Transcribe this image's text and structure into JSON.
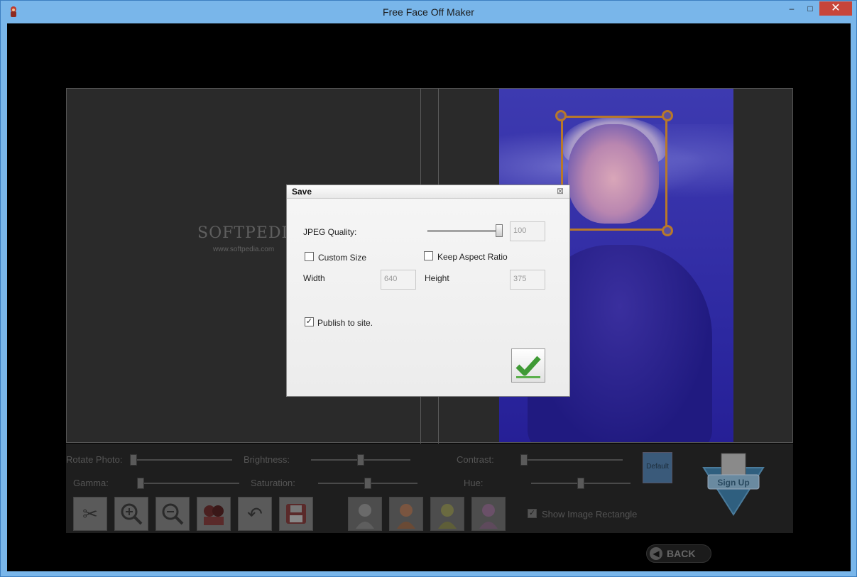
{
  "window": {
    "title": "Free Face Off Maker",
    "minimize_symbol": "–",
    "maximize_symbol": "□",
    "close_symbol": "✕"
  },
  "watermark": {
    "text": "SOFTPEDIA",
    "sub": "www.softpedia.com"
  },
  "controls": {
    "rotate_label": "Rotate Photo:",
    "brightness_label": "Brightness:",
    "contrast_label": "Contrast:",
    "gamma_label": "Gamma:",
    "saturation_label": "Saturation:",
    "hue_label": "Hue:",
    "default_label": "Default",
    "signup_label": "Sign Up",
    "show_rect_label": "Show Image Rectangle",
    "show_rect_checked": true,
    "back_label": "BACK",
    "slider_levels": {
      "rotate": 0.0,
      "brightness": 0.5,
      "contrast": 0.0,
      "gamma": 0.0,
      "saturation": 0.5,
      "hue": 0.5
    },
    "tools": [
      "scissors-icon",
      "zoom-in-icon",
      "zoom-out-icon",
      "faces-icon",
      "undo-icon",
      "save-disk-icon"
    ],
    "face_styles": [
      "face-style-gray-icon",
      "face-style-orange-icon",
      "face-style-yellow-icon",
      "face-style-pink-icon"
    ]
  },
  "dialog": {
    "title": "Save",
    "close_symbol": "⊠",
    "jpeg_quality_label": "JPEG Quality:",
    "jpeg_quality_value": "100",
    "jpeg_quality_level": 1.0,
    "custom_size_label": "Custom Size",
    "custom_size_checked": false,
    "keep_aspect_label": "Keep Aspect Ratio",
    "keep_aspect_checked": false,
    "width_label": "Width",
    "width_value": "640",
    "height_label": "Height",
    "height_value": "375",
    "publish_label": "Publish to site.",
    "publish_checked": true,
    "ok_icon": "checkmark-icon"
  },
  "colors": {
    "dialog_bg": "#f0f0f0",
    "photo_tint": "#3530a8",
    "face_rect": "#b8782a",
    "close_button": "#c7453a"
  }
}
